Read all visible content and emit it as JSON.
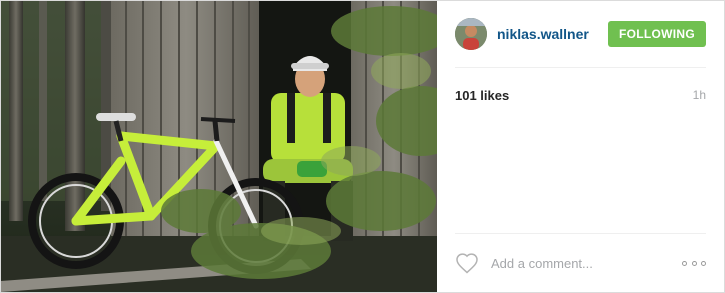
{
  "post": {
    "photo_icon": "mountain-bike-rider-photo",
    "author": {
      "username": "niklas.wallner",
      "avatar_icon": "avatar-icon"
    },
    "follow_button_label": "FOLLOWING",
    "likes_text": "101 likes",
    "timestamp": "1h",
    "comment_placeholder": "Add a comment...",
    "icons": {
      "like": "heart-icon",
      "more": "more-options-icon"
    },
    "colors": {
      "username": "#125688",
      "follow_button": "#70c050",
      "muted_text": "#a5a7aa",
      "divider": "#efefef"
    }
  }
}
